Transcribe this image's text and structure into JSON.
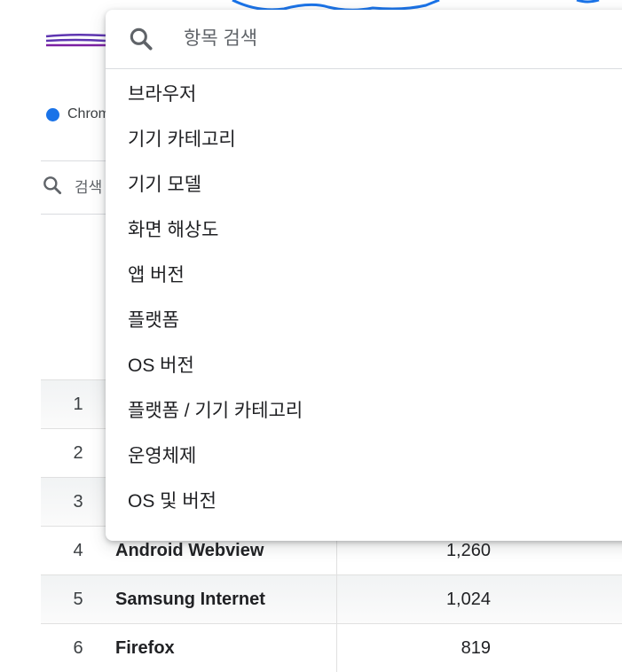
{
  "colors": {
    "line_blue": "#1a73e8",
    "line_purple": "#5e35b1",
    "legend_chrome": "#1a73e8",
    "shaded_row": "#f1f3f4"
  },
  "legend": {
    "chrome_label": "Chrom"
  },
  "table_search": {
    "label": "검색",
    "icon": "search-icon"
  },
  "table": {
    "rows": [
      {
        "index": "1",
        "name": "",
        "value": ""
      },
      {
        "index": "2",
        "name": "",
        "value": ""
      },
      {
        "index": "3",
        "name": "",
        "value": ""
      },
      {
        "index": "4",
        "name": "Android Webview",
        "value": "1,260"
      },
      {
        "index": "5",
        "name": "Samsung Internet",
        "value": "1,024"
      },
      {
        "index": "6",
        "name": "Firefox",
        "value": "819"
      }
    ]
  },
  "dropdown": {
    "search_placeholder": "항목 검색",
    "search_icon": "search-icon",
    "items": [
      {
        "label": "브라우저"
      },
      {
        "label": "기기 카테고리"
      },
      {
        "label": "기기 모델"
      },
      {
        "label": "화면 해상도"
      },
      {
        "label": "앱 버전"
      },
      {
        "label": "플랫폼"
      },
      {
        "label": "OS 버전"
      },
      {
        "label": "플랫폼 / 기기 카테고리"
      },
      {
        "label": "운영체제"
      },
      {
        "label": "OS 및 버전"
      }
    ]
  }
}
